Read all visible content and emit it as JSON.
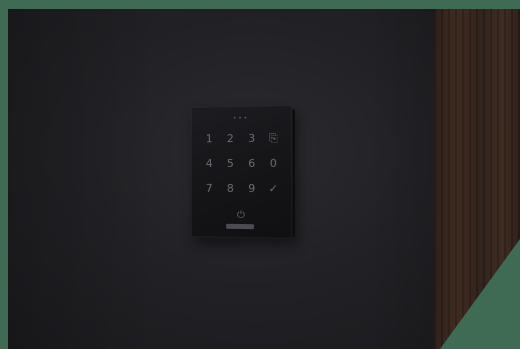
{
  "keypad": {
    "status_dots": "•••",
    "keys": [
      "1",
      "2",
      "3",
      "⎘",
      "4",
      "5",
      "6",
      "0",
      "7",
      "8",
      "9",
      "✓"
    ],
    "power_icon": "⏻"
  },
  "colors": {
    "frame": "#3f6b55",
    "wall": "#222125",
    "wood": "#3a271d",
    "keypad": "#141417",
    "key_text": "#6e6d73"
  },
  "icons": [
    "power-icon",
    "check-icon",
    "cancel-icon"
  ]
}
